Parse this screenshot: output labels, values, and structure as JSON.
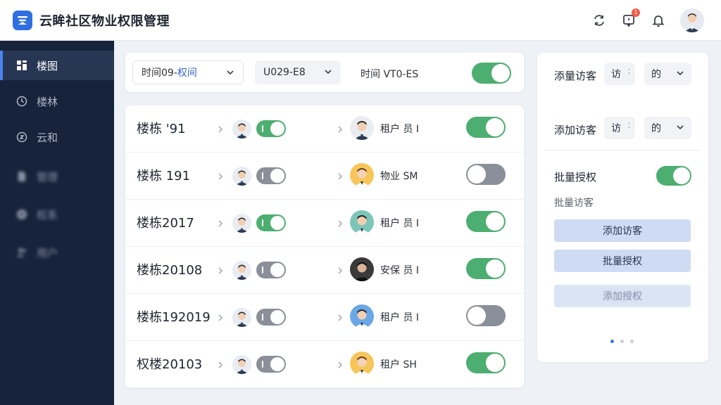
{
  "header": {
    "app_title": "云眸社区物业权限管理",
    "notification_badge": "1"
  },
  "sidebar": {
    "items": [
      {
        "label": "楼图",
        "icon": "building-grid-icon",
        "active": true
      },
      {
        "label": "楼林",
        "icon": "clock-icon",
        "active": false
      },
      {
        "label": "云和",
        "icon": "cloud-circle-icon",
        "active": false
      },
      {
        "label": "管理",
        "icon": "document-icon",
        "active": false
      },
      {
        "label": "权系",
        "icon": "fan-icon",
        "active": false
      },
      {
        "label": "用户",
        "icon": "users-icon",
        "active": false
      }
    ]
  },
  "filters": {
    "time_select": {
      "prefix": "时间09-",
      "highlight": "权间"
    },
    "code_select": {
      "value": "U029-E8"
    },
    "time_label": "时间 VT0-ES",
    "global_toggle_on": true
  },
  "rows": [
    {
      "building": "楼栋 '91",
      "resident_toggle_on": true,
      "person": "租户 员 I",
      "access_on": true
    },
    {
      "building": "楼栋 191",
      "resident_toggle_on": false,
      "person": "物业 SM",
      "access_on": false
    },
    {
      "building": "楼栋2017",
      "resident_toggle_on": true,
      "person": "租户 员 I",
      "access_on": true
    },
    {
      "building": "楼栋20108",
      "resident_toggle_on": false,
      "person": "安保 员 I",
      "access_on": true
    },
    {
      "building": "楼栋192019",
      "resident_toggle_on": false,
      "person": "租户 员 I",
      "access_on": false
    },
    {
      "building": "权楼20103",
      "resident_toggle_on": false,
      "person": "租户 SH",
      "access_on": true
    }
  ],
  "panel": {
    "row1_label": "添量访客",
    "row1_sel_a": "访",
    "row1_sel_b": "的",
    "row2_label": "添加访客",
    "row2_sel_a": "访",
    "row2_sel_b": "的",
    "batch_label": "批量授权",
    "batch_toggle_on": true,
    "sub_label": "批量访客",
    "btn_add_visitor": "添加访客",
    "btn_batch_auth": "批量授权",
    "btn_add_auth": "添加授权",
    "page_dots": 3,
    "active_dot": 0
  },
  "colors": {
    "sidebar_bg": "#17233b",
    "accent_blue": "#2f6fe0",
    "toggle_on": "#4cae70",
    "toggle_off": "#8a8f99",
    "badge_red": "#f05a4a"
  }
}
